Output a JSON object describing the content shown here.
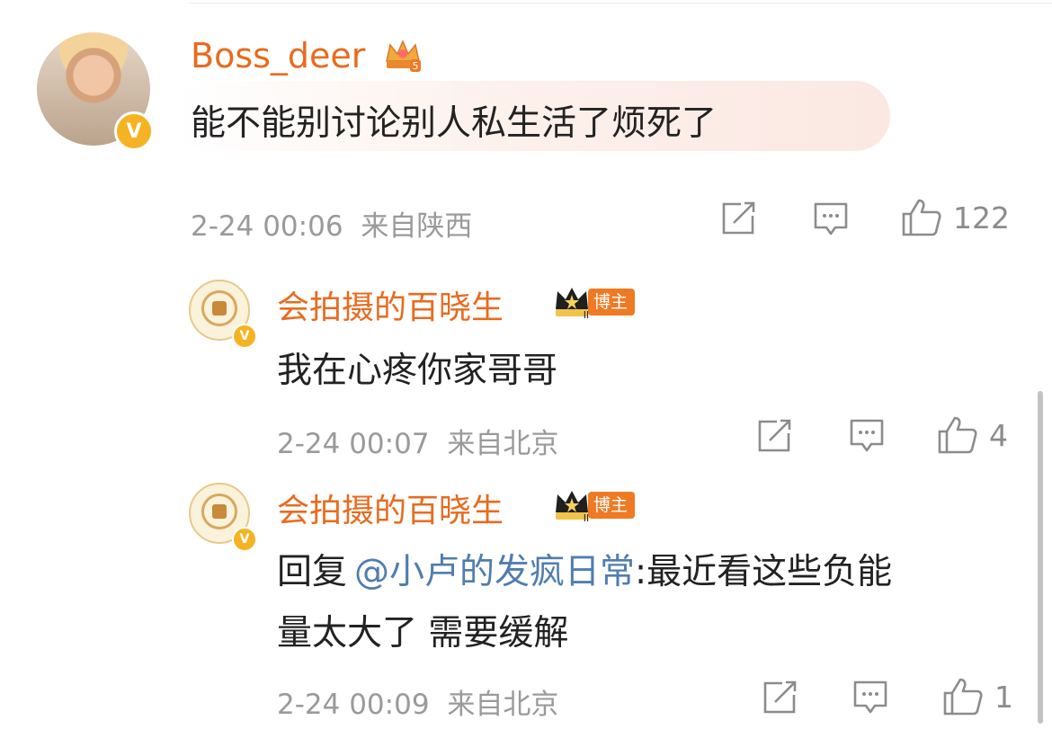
{
  "comment": {
    "username": "Boss_deer",
    "badge_icon": "crown-level-5-icon",
    "text": "能不能别讨论别人私生活了烦死了",
    "time": "2-24 00:06",
    "location": "来自陕西",
    "likes": "122"
  },
  "replies": [
    {
      "username": "会拍摄的百晓生",
      "badge_icon": "crown-level-2-icon",
      "badge_label": "博主",
      "text": "我在心疼你家哥哥",
      "time": "2-24 00:07",
      "location": "来自北京",
      "likes": "4"
    },
    {
      "username": "会拍摄的百晓生",
      "badge_icon": "crown-level-2-icon",
      "badge_label": "博主",
      "reply_prefix": "回复",
      "mention": "@小卢的发疯日常",
      "text_line1": ":最近看这些负能",
      "text_line2": "量太大了 需要缓解",
      "time": "2-24 00:09",
      "location": "来自北京",
      "likes": "1"
    }
  ],
  "colors": {
    "username": "#e86b1e",
    "mention": "#507daf",
    "meta": "#9a9a9a",
    "badge_tag": "#f07a24",
    "verify": "#f5b324"
  }
}
